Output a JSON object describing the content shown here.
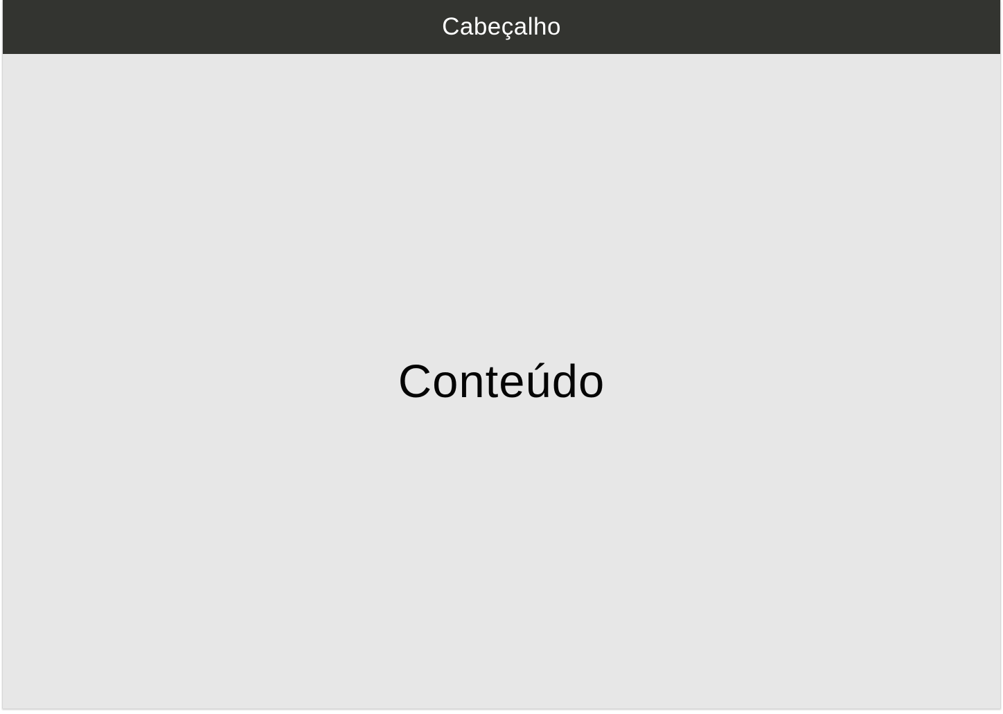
{
  "header": {
    "title": "Cabeçalho"
  },
  "main": {
    "text": "Conteúdo"
  },
  "colors": {
    "header_bg": "#333430",
    "content_bg": "#e7e7e7",
    "header_text": "#ffffff",
    "content_text": "#050505"
  }
}
